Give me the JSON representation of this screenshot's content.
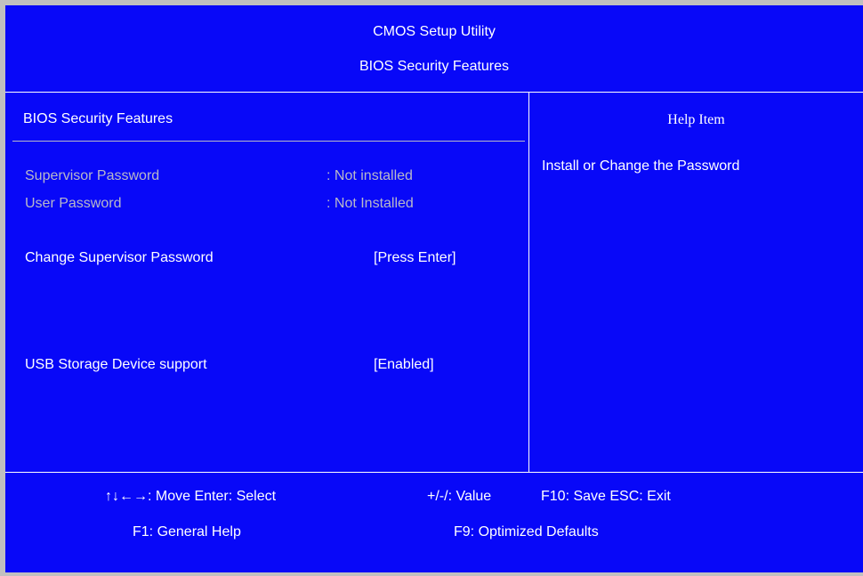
{
  "header": {
    "title": "CMOS Setup Utility",
    "subtitle": "BIOS Security Features"
  },
  "panel": {
    "title": "BIOS Security Features"
  },
  "items": [
    {
      "label": "Supervisor Password",
      "value": ": Not installed"
    },
    {
      "label": "User Password",
      "value": ": Not Installed"
    },
    {
      "label": "Change Supervisor Password",
      "value": "[Press Enter]"
    },
    {
      "label": "USB Storage Device support",
      "value": "[Enabled]"
    }
  ],
  "help": {
    "title": "Help Item",
    "text": "Install or Change the Password"
  },
  "footer": {
    "nav": "↑↓←→: Move Enter: Select",
    "value": "+/-/: Value",
    "save_exit": "F10: Save ESC: Exit",
    "help": "F1: General Help",
    "defaults": "F9: Optimized Defaults"
  },
  "colors": {
    "background": "#0808f8",
    "text": "#ffffff",
    "disabled_text": "#b8b8c8",
    "frame": "#c0c0c0"
  }
}
